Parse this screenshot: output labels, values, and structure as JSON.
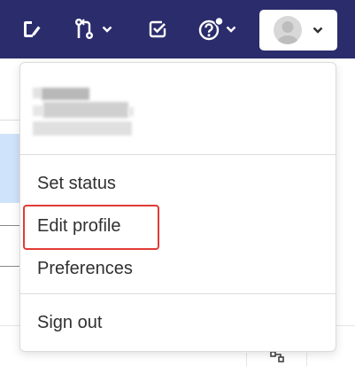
{
  "navbar": {
    "background": "#2b2c6b",
    "icons": [
      "edit-icon",
      "merge-request-icon",
      "todo-check-icon",
      "help-icon",
      "avatar"
    ],
    "help_notification_dot": true
  },
  "user_menu": {
    "items": [
      {
        "label": "Set status"
      },
      {
        "label": "Edit profile",
        "highlighted": true
      },
      {
        "label": "Preferences"
      },
      {
        "label": "Sign out"
      }
    ],
    "highlight_color": "#e23b36"
  }
}
